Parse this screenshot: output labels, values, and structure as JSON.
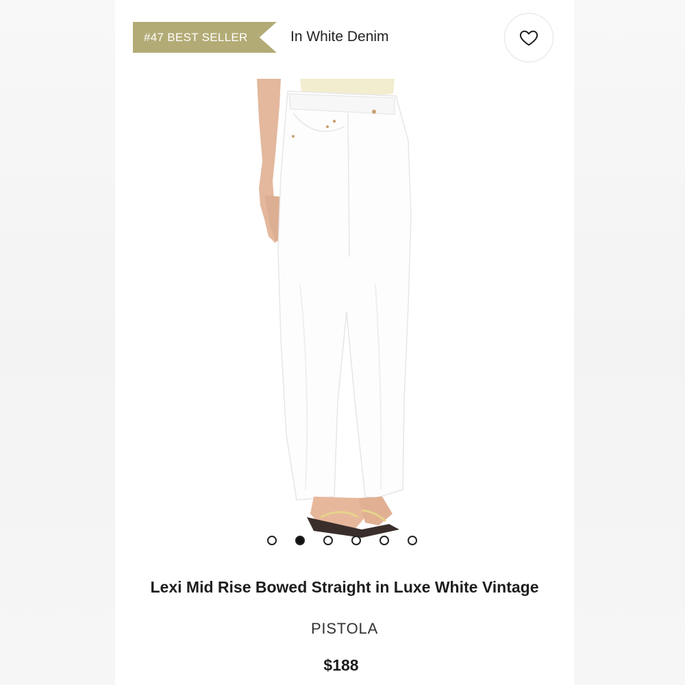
{
  "header": {
    "badge_label": "#47 BEST SELLER",
    "color_label": "In White Denim",
    "favorite_icon": "heart-icon"
  },
  "gallery": {
    "total_images": 6,
    "active_index": 2
  },
  "product": {
    "title": "Lexi Mid Rise Bowed Straight in Luxe White Vintage",
    "brand": "PISTOLA",
    "price": "$188"
  },
  "colors": {
    "badge": "#b3ab76",
    "text": "#1d1d1d",
    "background": "#ffffff"
  }
}
